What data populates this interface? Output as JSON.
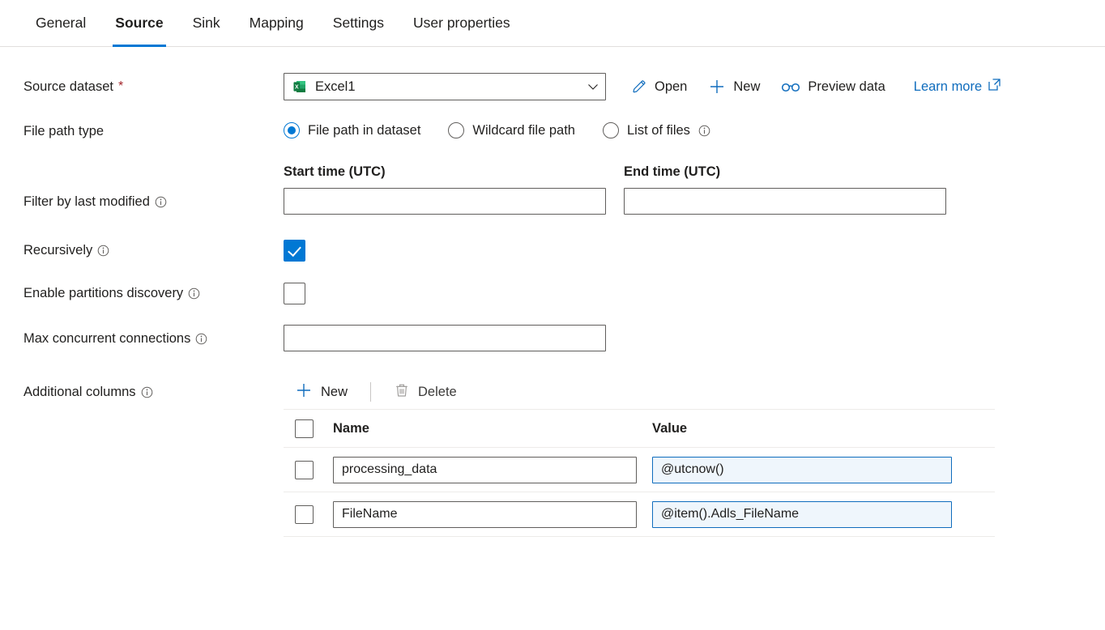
{
  "tabs": [
    {
      "label": "General",
      "active": false
    },
    {
      "label": "Source",
      "active": true
    },
    {
      "label": "Sink",
      "active": false
    },
    {
      "label": "Mapping",
      "active": false
    },
    {
      "label": "Settings",
      "active": false
    },
    {
      "label": "User properties",
      "active": false
    }
  ],
  "accent_color": "#0078d4",
  "link_color": "#0f6cbd",
  "required_color": "#a4262c",
  "source_dataset": {
    "label": "Source dataset",
    "required_marker": "*",
    "value": "Excel1",
    "icon": "excel-file-icon",
    "chevron_icon": "chevron-down-icon"
  },
  "commands": [
    {
      "label": "Open",
      "icon": "pencil-icon"
    },
    {
      "label": "New",
      "icon": "plus-icon"
    },
    {
      "label": "Preview data",
      "icon": "glasses-icon"
    }
  ],
  "learn_more": {
    "label": "Learn more",
    "icon": "external-link-icon"
  },
  "file_path_type": {
    "label": "File path type",
    "options": [
      {
        "label": "File path in dataset",
        "selected": true,
        "info": false
      },
      {
        "label": "Wildcard file path",
        "selected": false,
        "info": false
      },
      {
        "label": "List of files",
        "selected": false,
        "info": true
      }
    ]
  },
  "filter_by_last_modified": {
    "label": "Filter by last modified",
    "start_label": "Start time (UTC)",
    "end_label": "End time (UTC)",
    "start_value": "",
    "end_value": "",
    "start_placeholder": "",
    "end_placeholder": ""
  },
  "recursively": {
    "label": "Recursively",
    "checked": true
  },
  "enable_partitions_discovery": {
    "label": "Enable partitions discovery",
    "checked": false
  },
  "max_concurrent_connections": {
    "label": "Max concurrent connections",
    "value": "",
    "placeholder": ""
  },
  "additional_columns": {
    "label": "Additional columns",
    "toolbar": {
      "new_label": "New",
      "new_icon": "plus-icon",
      "delete_label": "Delete",
      "delete_icon": "trash-icon",
      "delete_disabled": true
    },
    "columns": [
      {
        "key": "name",
        "header": "Name"
      },
      {
        "key": "value",
        "header": "Value"
      }
    ],
    "header_checkbox_checked": false,
    "rows": [
      {
        "checked": false,
        "name": "processing_data",
        "value": "@utcnow()"
      },
      {
        "checked": false,
        "name": "FileName",
        "value": "@item().Adls_FileName"
      }
    ]
  }
}
